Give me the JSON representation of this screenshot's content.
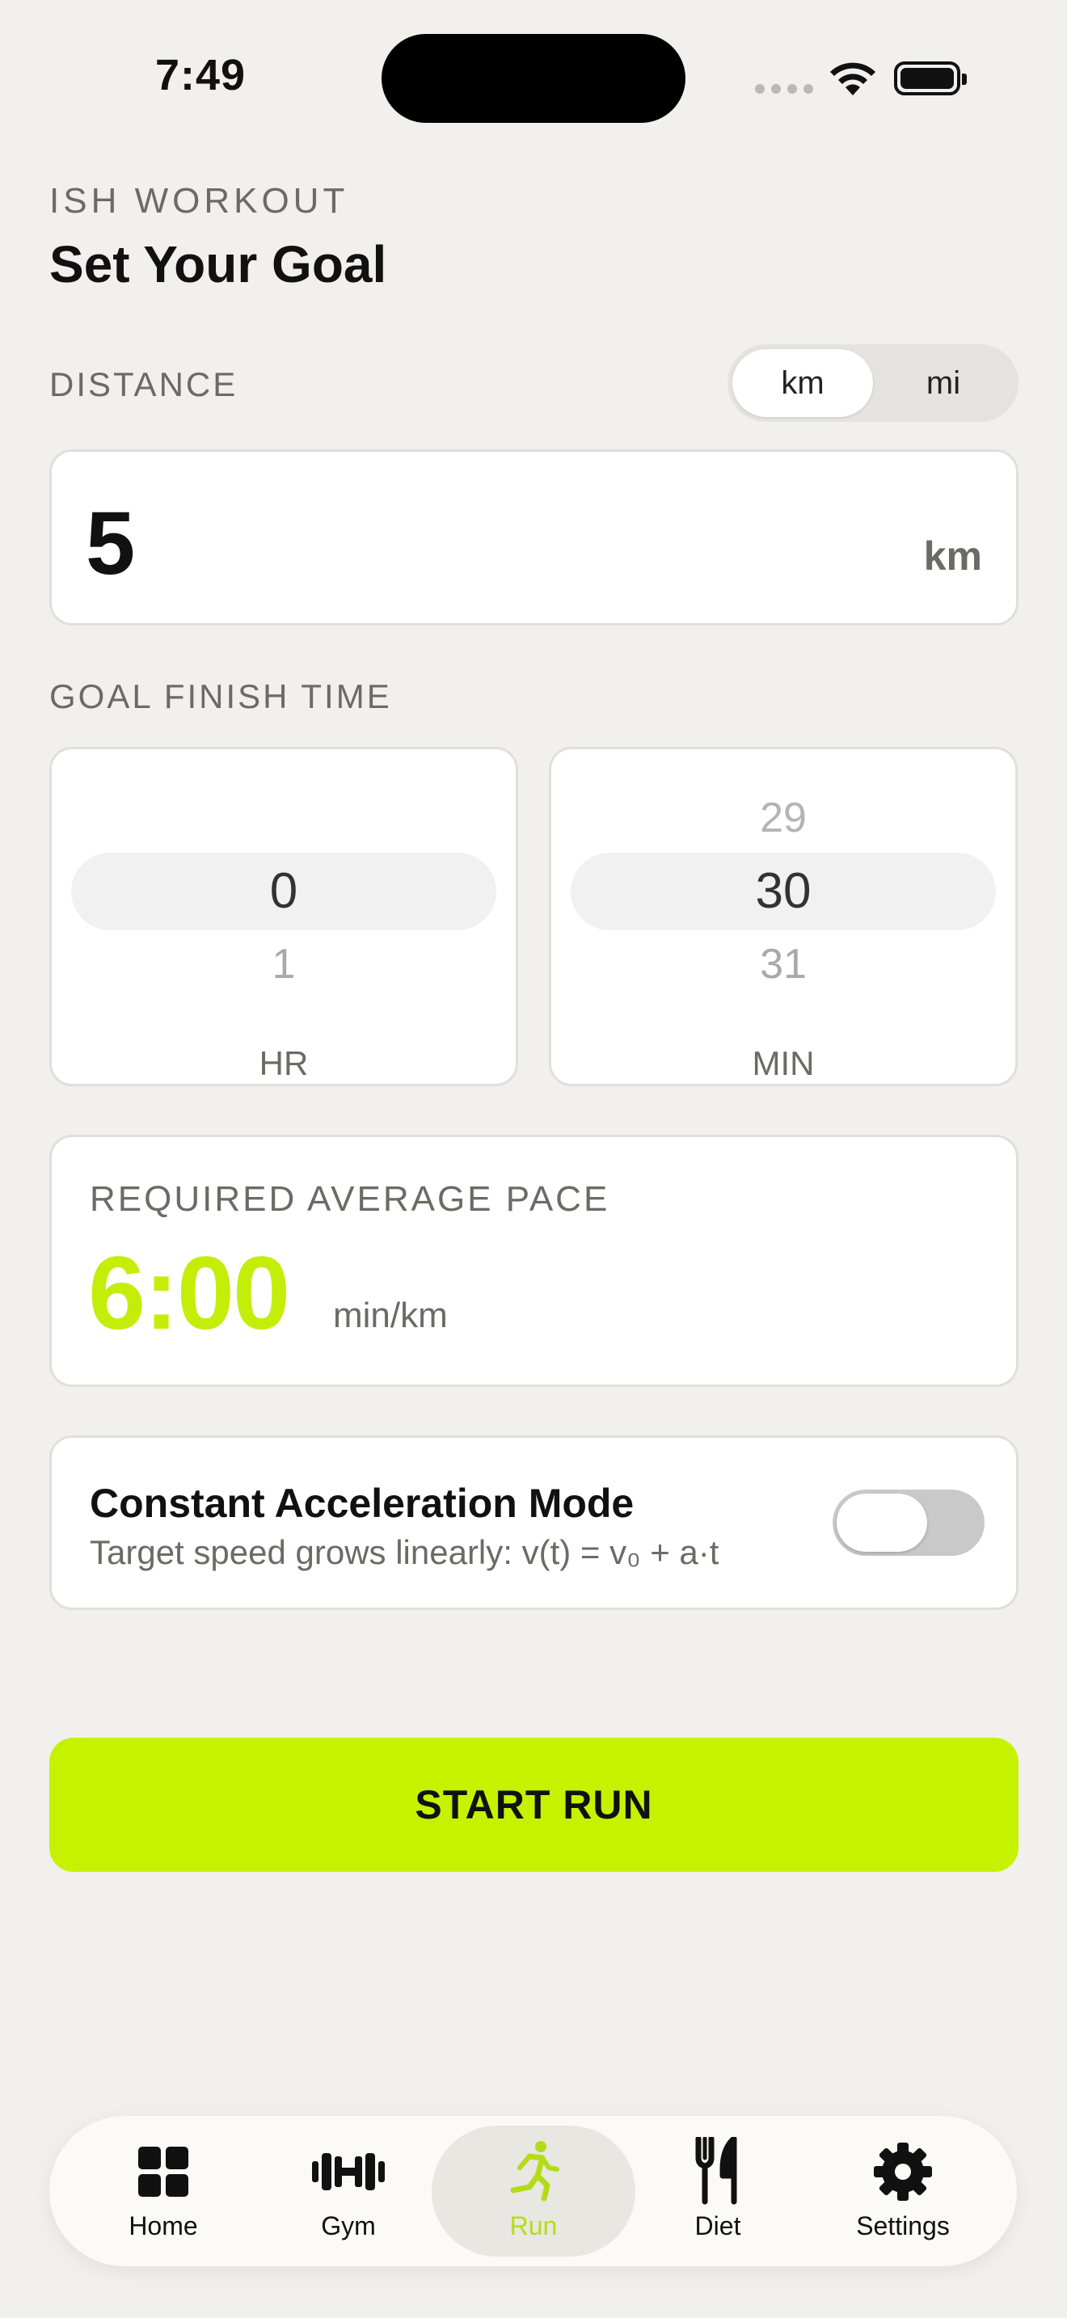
{
  "status": {
    "time": "7:49"
  },
  "header": {
    "kicker": "ISH WORKOUT",
    "title": "Set Your Goal"
  },
  "distance": {
    "label": "DISTANCE",
    "units": [
      {
        "label": "km",
        "active": true
      },
      {
        "label": "mi",
        "active": false
      }
    ],
    "value": "5",
    "unit": "km"
  },
  "finish_time": {
    "label": "GOAL FINISH TIME",
    "hours": {
      "prev": "",
      "selected": "0",
      "next": "1",
      "caption": "HR"
    },
    "minutes": {
      "prev": "29",
      "selected": "30",
      "next": "31",
      "caption": "MIN"
    }
  },
  "pace": {
    "label": "REQUIRED AVERAGE PACE",
    "value": "6:00",
    "unit": "min/km"
  },
  "acceleration": {
    "title": "Constant Acceleration Mode",
    "subtitle": "Target speed grows linearly: v(t) = v₀ + a·t",
    "enabled": false
  },
  "start_button": {
    "label": "START RUN"
  },
  "tabbar": {
    "items": [
      {
        "label": "Home",
        "icon": "grid-icon",
        "active": false
      },
      {
        "label": "Gym",
        "icon": "dumbbell-icon",
        "active": false
      },
      {
        "label": "Run",
        "icon": "runner-icon",
        "active": true
      },
      {
        "label": "Diet",
        "icon": "fork-knife-icon",
        "active": false
      },
      {
        "label": "Settings",
        "icon": "gear-icon",
        "active": false
      }
    ]
  },
  "colors": {
    "accent": "#c6f200",
    "pace_text": "#c4ee0a",
    "tab_active": "#b4dc16",
    "background": "#f1f0ec"
  }
}
